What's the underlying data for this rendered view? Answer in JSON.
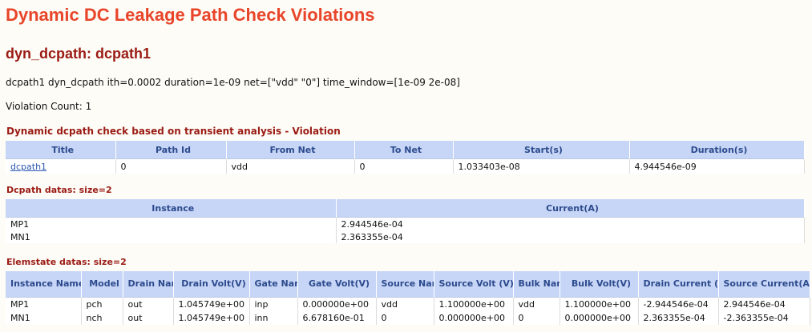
{
  "page_title": "Dynamic DC Leakage Path Check Violations",
  "section_title": "dyn_dcpath: dcpath1",
  "command_line": "dcpath1 dyn_dcpath ith=0.0002 duration=1e-09 net=[\"vdd\" \"0\"] time_window=[1e-09 2e-08]",
  "violation_count": "Violation Count: 1",
  "violation_table": {
    "label": "Dynamic dcpath check based on transient analysis - Violation",
    "headers": [
      "Title",
      "Path Id",
      "From Net",
      "To Net",
      "Start(s)",
      "Duration(s)"
    ],
    "rows": [
      [
        "dcpath1",
        "0",
        "vdd",
        "0",
        "1.033403e-08",
        "4.944546e-09"
      ]
    ]
  },
  "dcpath_table": {
    "label": "Dcpath datas: size=2",
    "headers": [
      "Instance",
      "Current(A)"
    ],
    "rows": [
      [
        "MP1",
        "2.944546e-04"
      ],
      [
        "MN1",
        "2.363355e-04"
      ]
    ]
  },
  "elemstate_table": {
    "label": "Elemstate datas: size=2",
    "sort_indicator": "▲",
    "headers": [
      "Instance Name",
      "Model",
      "Drain Name",
      "Drain Volt(V)",
      "Gate Name",
      "Gate Volt(V)",
      "Source Name",
      "Source Volt (V)",
      "Bulk Name",
      "Bulk Volt(V)",
      "Drain Current (A)",
      "Source Current(A)"
    ],
    "rows": [
      [
        "MP1",
        "pch",
        "out",
        "1.045749e+00",
        "inp",
        "0.000000e+00",
        "vdd",
        "1.100000e+00",
        "vdd",
        "1.100000e+00",
        "-2.944546e-04",
        "2.944546e-04"
      ],
      [
        "MN1",
        "nch",
        "out",
        "1.045749e+00",
        "inn",
        "6.678160e-01",
        "0",
        "0.000000e+00",
        "0",
        "0.000000e+00",
        "2.363355e-04",
        "-2.363355e-04"
      ]
    ]
  },
  "colors": {
    "page_title": "#e8452a",
    "section_title": "#9b1b14",
    "header_bg": "#c7d6f7",
    "header_text": "#2c4a8c",
    "link": "#2a56b0"
  }
}
